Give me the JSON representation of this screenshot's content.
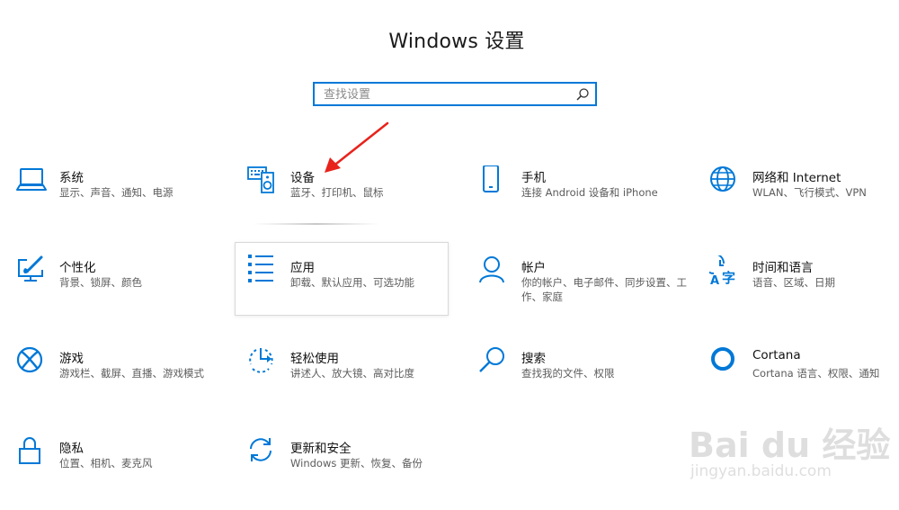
{
  "window": {
    "title": "Windows 设置"
  },
  "search": {
    "placeholder": "查找设置"
  },
  "tiles": [
    {
      "name": "系统",
      "desc": "显示、声音、通知、电源",
      "icon": "laptop-icon"
    },
    {
      "name": "设备",
      "desc": "蓝牙、打印机、鼠标",
      "icon": "keyboard-speaker-icon"
    },
    {
      "name": "手机",
      "desc": "连接 Android 设备和 iPhone",
      "icon": "phone-icon"
    },
    {
      "name": "网络和 Internet",
      "desc": "WLAN、飞行模式、VPN",
      "icon": "globe-icon"
    },
    {
      "name": "个性化",
      "desc": "背景、锁屏、颜色",
      "icon": "paint-monitor-icon"
    },
    {
      "name": "应用",
      "desc": "卸载、默认应用、可选功能",
      "icon": "app-list-icon"
    },
    {
      "name": "帐户",
      "desc": "你的帐户、电子邮件、同步设置、工作、家庭",
      "icon": "person-icon"
    },
    {
      "name": "时间和语言",
      "desc": "语音、区域、日期",
      "icon": "time-language-icon"
    },
    {
      "name": "游戏",
      "desc": "游戏栏、截屏、直播、游戏模式",
      "icon": "xbox-icon"
    },
    {
      "name": "轻松使用",
      "desc": "讲述人、放大镜、高对比度",
      "icon": "ease-of-access-icon"
    },
    {
      "name": "搜索",
      "desc": "查找我的文件、权限",
      "icon": "search-icon"
    },
    {
      "name": "Cortana",
      "desc": "Cortana 语言、权限、通知",
      "icon": "cortana-ring-icon"
    },
    {
      "name": "隐私",
      "desc": "位置、相机、麦克风",
      "icon": "lock-icon"
    },
    {
      "name": "更新和安全",
      "desc": "Windows 更新、恢复、备份",
      "icon": "sync-icon"
    }
  ],
  "watermark": {
    "brand": "Bai du 经验",
    "sub": "jingyan.baidu.com"
  },
  "colors": {
    "accent": "#0078d7",
    "annotation_arrow": "#e8231c"
  }
}
